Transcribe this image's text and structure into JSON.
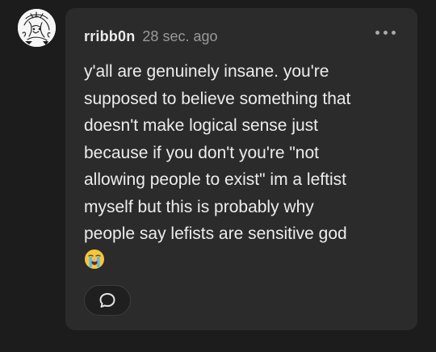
{
  "comment": {
    "username": "rribb0n",
    "timestamp": "28 sec. ago",
    "text": "y'all are genuinely insane. you're\nsupposed to believe something that\ndoesn't make logical sense just\nbecause if you don't you're \"not\nallowing people to exist\" im a leftist\nmyself but this is probably why\npeople say lefists are sensitive god",
    "emoji": "loudly-crying-face",
    "more_icon": "more-horizontal-icon",
    "reply_icon": "speech-bubble-icon"
  },
  "colors": {
    "background": "#1c1c1c",
    "card": "#2b2b2b",
    "text": "#ededed",
    "muted": "#9a9a9a"
  }
}
